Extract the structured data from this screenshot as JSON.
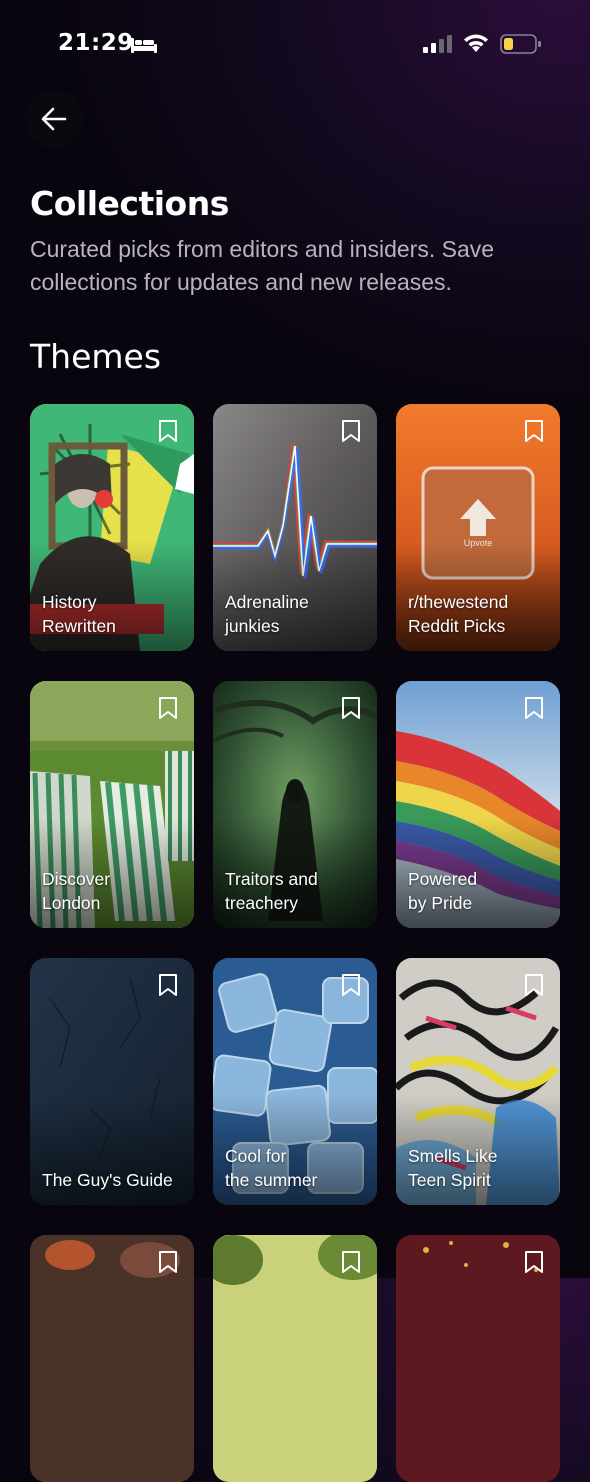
{
  "status_bar": {
    "time": "21:29",
    "icons": [
      "bed-icon",
      "cellular-signal-icon",
      "wifi-icon",
      "battery-low-icon"
    ],
    "battery_color": "#f5d547"
  },
  "header": {
    "back_icon": "arrow-left-icon",
    "title": "Collections",
    "subtitle": "Curated picks from editors and insiders. Save collections for updates and new releases."
  },
  "themes": {
    "heading": "Themes",
    "cards": [
      {
        "label": "History\nRewritten",
        "bookmark_icon": "bookmark-icon"
      },
      {
        "label": "Adrenaline\njunkies",
        "bookmark_icon": "bookmark-icon"
      },
      {
        "label": "r/thewestend\nReddit Picks",
        "bookmark_icon": "bookmark-icon",
        "badge": "Upvote"
      },
      {
        "label": "Discover\nLondon",
        "bookmark_icon": "bookmark-icon"
      },
      {
        "label": "Traitors and\ntreachery",
        "bookmark_icon": "bookmark-icon"
      },
      {
        "label": "Powered\nby Pride",
        "bookmark_icon": "bookmark-icon"
      },
      {
        "label": "The Guy's Guide",
        "bookmark_icon": "bookmark-icon"
      },
      {
        "label": "Cool for\nthe summer",
        "bookmark_icon": "bookmark-icon"
      },
      {
        "label": "Smells Like\nTeen Spirit",
        "bookmark_icon": "bookmark-icon"
      }
    ]
  }
}
